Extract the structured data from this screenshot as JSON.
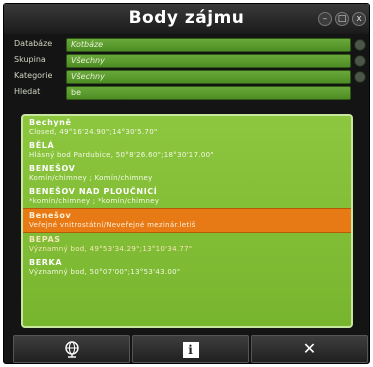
{
  "window": {
    "title": "Body zájmu",
    "controls": {
      "minimize": "–",
      "maximize": "□",
      "close": "x"
    }
  },
  "fields": [
    {
      "label": "Databáze",
      "value": "Kotbáze"
    },
    {
      "label": "Skupina",
      "value": "Všechny"
    },
    {
      "label": "Kategorie",
      "value": "Všechny"
    },
    {
      "label": "Hledat",
      "value": "be"
    }
  ],
  "list": {
    "items": [
      {
        "name": "Bechyně",
        "desc": "Closed, 49°16'24.90\";14°30'5.70\"",
        "state": "normal"
      },
      {
        "name": "BĚLÁ",
        "desc": "Hlásný bod Pardubice, 50°8'26.60\";18°30'17.00\"",
        "state": "normal"
      },
      {
        "name": "BENEŠOV",
        "desc": "Komín/chimney ; Komín/chimney",
        "state": "normal"
      },
      {
        "name": "BENEŠOV NAD PLOUČNICÍ",
        "desc": "*komín/chimney ; *komín/chimney",
        "state": "normal"
      },
      {
        "name": "Benešov",
        "desc": "Veřejné vnitrostátní/Neveřejné mezinár.letiš",
        "state": "selected"
      },
      {
        "name": "BEPAS",
        "desc": "Významný bod, 49°53'34.29\";13°10'34.77\"",
        "state": "dim"
      },
      {
        "name": "BERKA",
        "desc": "Významný bod, 50°07'00\";13°53'43.00\"",
        "state": "normal"
      }
    ]
  },
  "toolbar": {
    "globe_icon": "globe-icon",
    "info_label": "i",
    "close_label": "✕"
  },
  "colors": {
    "accent_green": "#8dc63f",
    "selection_orange": "#e87a16",
    "window_bg": "#141414"
  }
}
